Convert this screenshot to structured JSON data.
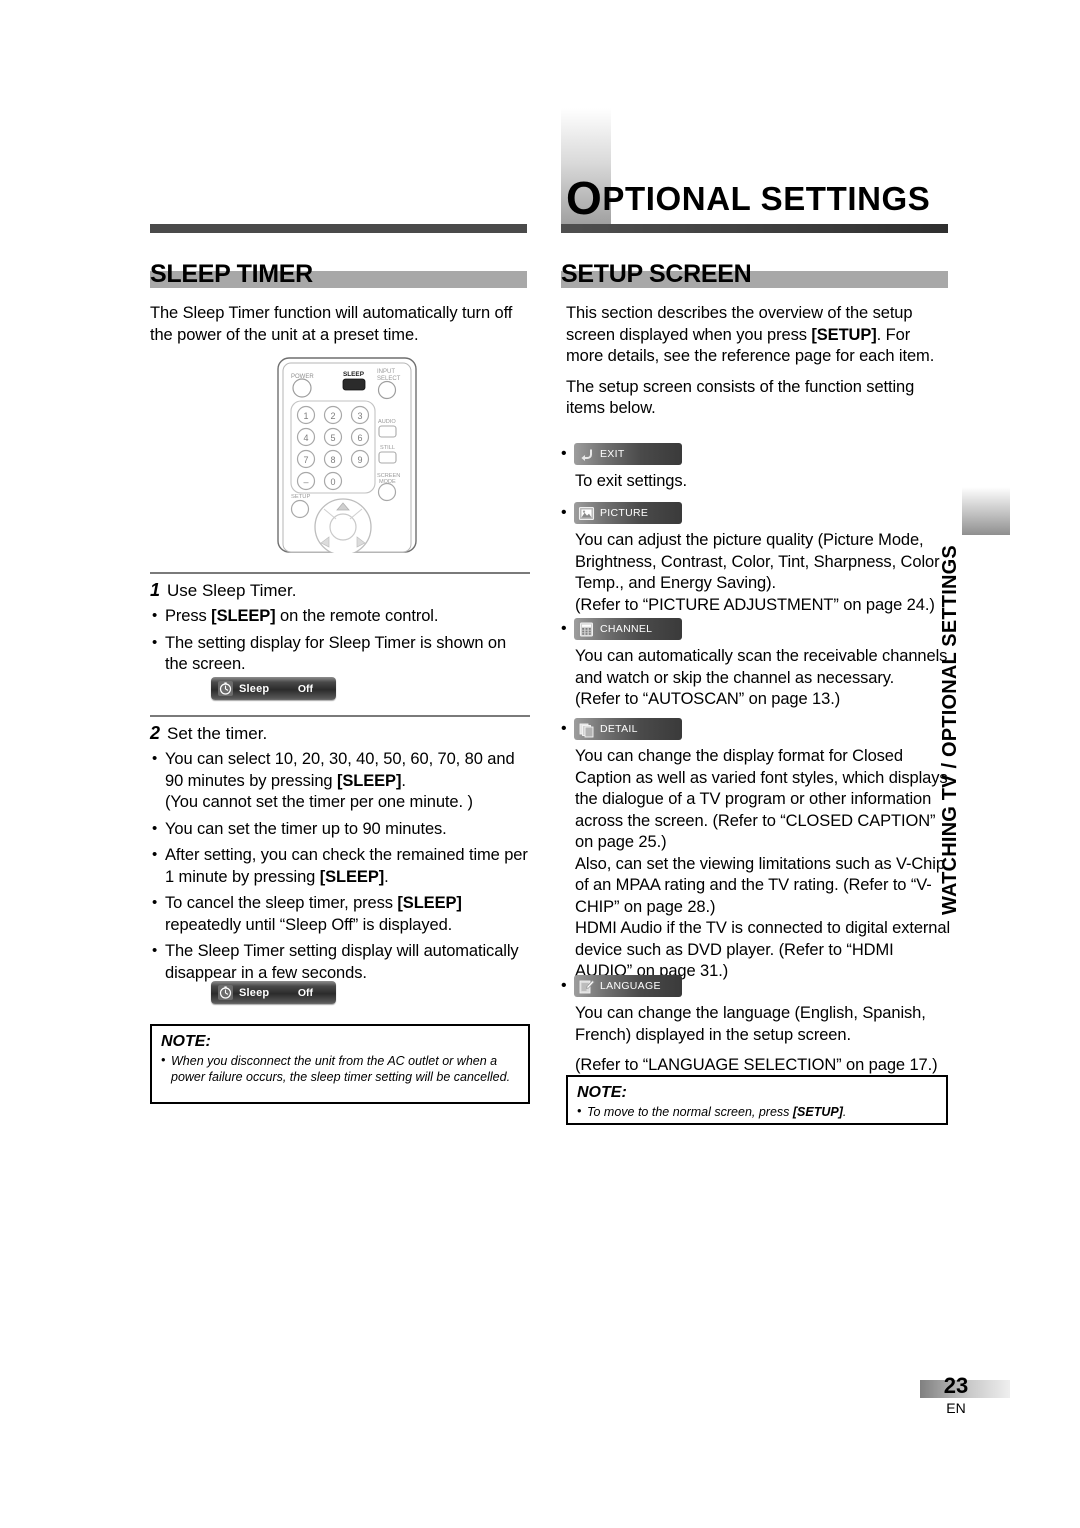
{
  "chapter": {
    "dropcap": "O",
    "title_rest": "PTIONAL SETTINGS"
  },
  "sections": {
    "sleep_timer": {
      "heading": "SLEEP TIMER",
      "intro": "The Sleep Timer function will automatically turn off the power of the unit at a preset time.",
      "steps": [
        {
          "number": "1",
          "title": "Use Sleep Timer.",
          "bullets": [
            "Press [SLEEP] on the remote control.",
            "The setting display for Sleep Timer is shown on the screen."
          ],
          "bold_tokens": [
            "[SLEEP]"
          ]
        },
        {
          "number": "2",
          "title": "Set the timer.",
          "bullets": [
            "You can select 10, 20, 30, 40, 50, 60, 70, 80 and 90 minutes by pressing [SLEEP].",
            "(You cannot set the timer per one minute. )",
            "You can set the timer up to 90 minutes.",
            "After setting, you can check the remained time per 1 minute by pressing [SLEEP].",
            "To cancel the sleep timer, press [SLEEP] repeatedly until “Sleep Off” is displayed.",
            "The Sleep Timer setting display will automatically disappear in a few seconds."
          ]
        }
      ],
      "osd": {
        "icon": "sleep-clock-icon",
        "label": "Sleep",
        "value": "Off"
      },
      "note": {
        "title": "NOTE:",
        "text": "When you disconnect the unit from the AC outlet or when a power failure occurs, the sleep timer setting will be cancelled."
      }
    },
    "setup_screen": {
      "heading": "SETUP SCREEN",
      "intro_paragraphs": [
        "This section describes the overview of the setup screen displayed when you press [SETUP]. For more details, see the reference page for each item.",
        "The setup screen consists of the function setting items below."
      ],
      "menu_items": [
        {
          "icon": "exit-return-arrow-icon",
          "label": "EXIT",
          "description_paragraphs": [
            "To exit settings."
          ]
        },
        {
          "icon": "picture-image-icon",
          "label": "PICTURE",
          "description_paragraphs": [
            "You can adjust the picture quality (Picture Mode, Brightness, Contrast, Color, Tint, Sharpness, Color Temp., and Energy Saving).",
            "(Refer to “PICTURE ADJUSTMENT” on page 24.)"
          ]
        },
        {
          "icon": "channel-grid-icon",
          "label": "CHANNEL",
          "description_paragraphs": [
            "You can automatically scan the receivable channels and watch or skip the channel as necessary.",
            "(Refer to “AUTOSCAN” on page 13.)"
          ]
        },
        {
          "icon": "detail-pages-icon",
          "label": "DETAIL",
          "description_paragraphs": [
            "You can change the display format for Closed Caption as well as varied font styles, which displays the dialogue of a TV program or other information across the screen. (Refer to “CLOSED CAPTION” on page 25.)",
            "Also, can set the viewing limitations such as V-Chip of an MPAA rating and the TV rating. (Refer to “V-CHIP” on page 28.)",
            "HDMI Audio if the TV is connected to digital external device such as DVD player. (Refer to “HDMI AUDIO” on page 31.)"
          ]
        },
        {
          "icon": "language-notepad-pencil-icon",
          "label": "LANGUAGE",
          "description_paragraphs": [
            "You can change the language (English, Spanish, French) displayed in the setup screen.",
            "(Refer to “LANGUAGE SELECTION” on page 17.)"
          ]
        }
      ],
      "note": {
        "title": "NOTE:",
        "text": "To move to the normal screen, press [SETUP]."
      }
    }
  },
  "remote": {
    "buttons": {
      "power": "POWER",
      "sleep": "SLEEP",
      "input_select_line1": "INPUT",
      "input_select_line2": "SELECT",
      "audio": "AUDIO",
      "still": "STILL",
      "setup": "SETUP",
      "screen_mode_line1": "SCREEN",
      "screen_mode_line2": "MODE"
    },
    "keypad": [
      "1",
      "2",
      "3",
      "4",
      "5",
      "6",
      "7",
      "8",
      "9",
      "–",
      "0"
    ]
  },
  "side_tab": {
    "text": "WATCHING TV / OPTIONAL SETTINGS"
  },
  "footer": {
    "page_number": "23",
    "language_code": "EN"
  }
}
